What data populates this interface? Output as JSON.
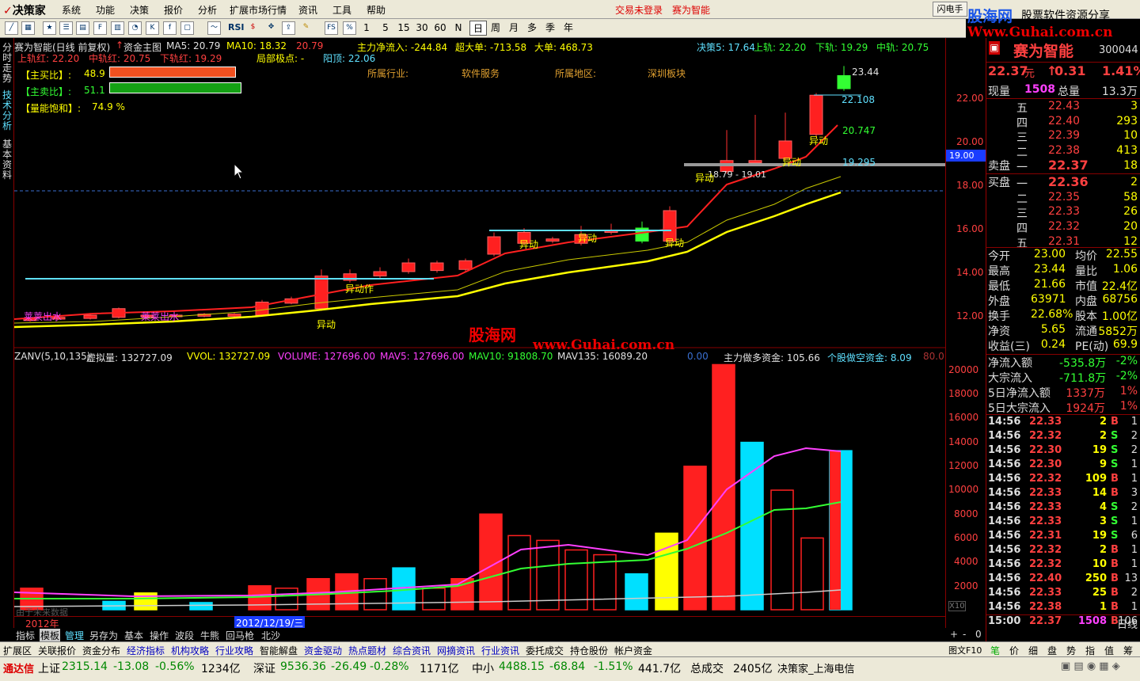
{
  "menubar": {
    "logo": "决策家",
    "items": [
      "系统",
      "功能",
      "决策",
      "报价",
      "分析",
      "扩展市场行情",
      "资讯",
      "工具",
      "帮助"
    ],
    "links": [
      "交易未登录",
      "赛为智能"
    ],
    "flash_btn": "闪电手",
    "ad_brand": "股海网",
    "ad_slogan": "股票软件资源分享",
    "ad_url": "Www.Guhai.com.cn"
  },
  "toolbar": {
    "icons": [
      "line-icon",
      "grid-icon",
      "fav-icon",
      "f10-icon",
      "fund-icon",
      "pie-icon",
      "k-icon",
      "tools-icon",
      "trend-icon",
      "rsi-icon",
      "money-icon",
      "move-icon",
      "export-icon",
      "pen-icon",
      "fs-icon",
      "pct-icon",
      "pick-icon"
    ],
    "rsi_label": "RSI",
    "periods": [
      "1",
      "5",
      "15",
      "30",
      "60",
      "N",
      "日",
      "周",
      "月",
      "多",
      "季",
      "年"
    ],
    "selected_period": "日"
  },
  "leftnav": {
    "items": [
      "分时走势",
      "技术分析",
      "基本资料"
    ]
  },
  "kline": {
    "title": "赛为智能(日线 前复权)",
    "main_chart_label": "资金主图",
    "ma5": "MA5: 20.79",
    "ma10": "MA10: 18.32",
    "ma_extra": "20.79",
    "main_inflow": "主力净流入: -244.84",
    "super_order": "超大单: -713.58",
    "big_order": "大单: 468.73",
    "upper_red": "上轨红: 22.20",
    "mid_red": "中轨红: 20.75",
    "lower_red": "下轨红: 19.29",
    "local_extreme": "局部极点: -",
    "resistance": "阳顶: 22.06",
    "decision5": "决策5: 17.64",
    "upper": "上轨: 22.20",
    "lower": "下轨: 19.29",
    "mid": "中轨: 20.75",
    "buy_ratio_label": "【主买比】:",
    "buy_ratio": "48.9",
    "sell_ratio_label": "【主卖比】:",
    "sell_ratio": "51.1",
    "pct_sign": "%",
    "energy_label": "【量能饱和】:",
    "energy": "74.9  %",
    "industry_label": "所属行业:",
    "industry": "软件服务",
    "region_label": "所属地区:",
    "region": "深圳板块",
    "yidong": "异动",
    "yidong_zuo": "异动作",
    "main_out": "莱莱出水",
    "price_22_44": "23.44",
    "price_22_108": "22.108",
    "price_20_747": "20.747",
    "price_19_295": "19.295",
    "range_text": "18.79 - 19.01",
    "hl_box": "19.00",
    "price_axis": [
      "22.00",
      "20.00",
      "18.00",
      "16.00",
      "14.00",
      "12.00"
    ]
  },
  "volume": {
    "zanv": "ZANV(5,10,135)",
    "virtual": "虚拟量: 132727.09",
    "vvol": "VVOL: 132727.09",
    "volume": "VOLUME: 127696.00",
    "mav5": "MAV5: 127696.00",
    "mav10": "MAV10: 91808.70",
    "mav135": "MAV135: 16089.20",
    "zero": "0.00",
    "main_long": "主力做多资金: 105.66",
    "retail_short": "个股做空资金: 8.09",
    "tail": "80.0",
    "axis": [
      "20000",
      "18000",
      "16000",
      "14000",
      "12000",
      "10000",
      "8000",
      "6000",
      "4000",
      "2000"
    ],
    "x10": "X10",
    "date_box": "2012/12/19/三",
    "year_label": "2012年",
    "no_data": "由于未来数据"
  },
  "watermark": {
    "text": "股海网",
    "url": "www.Guhai.com.cn"
  },
  "stock": {
    "name": "赛为智能",
    "code": "300044",
    "price": "22.37",
    "unit": "元",
    "change": "0.31",
    "pct": "1.41%",
    "now_label": "现量",
    "now_vol": "1508",
    "total_label": "总量",
    "total": "13.3万",
    "sell_label": "卖盘",
    "buy_label": "买盘",
    "sells": [
      {
        "lv": "五",
        "p": "22.43",
        "v": "3"
      },
      {
        "lv": "四",
        "p": "22.40",
        "v": "293"
      },
      {
        "lv": "三",
        "p": "22.39",
        "v": "10"
      },
      {
        "lv": "二",
        "p": "22.38",
        "v": "413"
      },
      {
        "lv": "一",
        "p": "22.37",
        "v": "18"
      }
    ],
    "buys": [
      {
        "lv": "一",
        "p": "22.36",
        "v": "2"
      },
      {
        "lv": "二",
        "p": "22.35",
        "v": "58"
      },
      {
        "lv": "三",
        "p": "22.33",
        "v": "26"
      },
      {
        "lv": "四",
        "p": "22.32",
        "v": "20"
      },
      {
        "lv": "五",
        "p": "22.31",
        "v": "12"
      }
    ],
    "stats": [
      [
        "今开",
        "23.00",
        "均价",
        "22.55"
      ],
      [
        "最高",
        "23.44",
        "量比",
        "1.06"
      ],
      [
        "最低",
        "21.66",
        "市值",
        "22.4亿"
      ],
      [
        "外盘",
        "63971",
        "内盘",
        "68756"
      ],
      [
        "换手",
        "22.68%",
        "股本",
        "1.00亿"
      ],
      [
        "净资",
        "5.65",
        "流通",
        "5852万"
      ],
      [
        "收益(三)",
        "0.24",
        "PE(动)",
        "69.9"
      ]
    ],
    "flows": [
      [
        "净流入额",
        "-535.8万",
        "-2%"
      ],
      [
        "大宗流入",
        "-711.8万",
        "-2%"
      ],
      [
        "5日净流入额",
        "1337万",
        "1%"
      ],
      [
        "5日大宗流入",
        "1924万",
        "1%"
      ]
    ],
    "ticks": [
      [
        "14:56",
        "22.33",
        "2",
        "B",
        "1"
      ],
      [
        "14:56",
        "22.32",
        "2",
        "S",
        "2"
      ],
      [
        "14:56",
        "22.30",
        "19",
        "S",
        "2"
      ],
      [
        "14:56",
        "22.30",
        "9",
        "S",
        "1"
      ],
      [
        "14:56",
        "22.32",
        "109",
        "B",
        "1"
      ],
      [
        "14:56",
        "22.33",
        "14",
        "B",
        "3"
      ],
      [
        "14:56",
        "22.33",
        "4",
        "S",
        "2"
      ],
      [
        "14:56",
        "22.33",
        "3",
        "S",
        "1"
      ],
      [
        "14:56",
        "22.31",
        "19",
        "S",
        "6"
      ],
      [
        "14:56",
        "22.32",
        "2",
        "B",
        "1"
      ],
      [
        "14:56",
        "22.32",
        "10",
        "B",
        "1"
      ],
      [
        "14:56",
        "22.40",
        "250",
        "B",
        "13"
      ],
      [
        "14:56",
        "22.33",
        "25",
        "B",
        "2"
      ],
      [
        "14:56",
        "22.38",
        "1",
        "B",
        "1"
      ],
      [
        "15:00",
        "22.37",
        "1508",
        "B",
        "106"
      ]
    ],
    "day_line": "日线",
    "plus": "+",
    "minus": "-",
    "zero": "0",
    "f10": "图文F10",
    "side_tabs": [
      "笔",
      "价",
      "细",
      "盘",
      "势",
      "指",
      "值",
      "筹"
    ]
  },
  "bottomtabs": [
    "指标",
    "模板",
    "管理",
    "另存为",
    "基本",
    "操作",
    "波段",
    "牛熊",
    "回马枪",
    "北沙"
  ],
  "funcbar": [
    "扩展区",
    "关联报价",
    "资金分布",
    "经济指标",
    "机构攻略",
    "行业攻略",
    "智能解盘",
    "资金驱动",
    "热点题材",
    "综合资讯",
    "网摘资讯",
    "行业资讯",
    "委托成交",
    "持仓股份",
    "帐户资金"
  ],
  "status": {
    "brand": "通达信",
    "sh_label": "上证",
    "sh": "2315.14",
    "sh_chg": "-13.08",
    "sh_pct": "-0.56%",
    "sh_amt": "1234亿",
    "sz_label": "深证",
    "sz": "9536.36",
    "sz_chg": "-26.49",
    "sz_pct": "-0.28%",
    "sz_amt": "1171亿",
    "zx_label": "中小",
    "zx": "4488.15",
    "zx_chg": "-68.84",
    "zx_pct": "-1.51%",
    "zx_amt": "441.7亿",
    "total_label": "总成交",
    "total": "2405亿",
    "server": "决策家_上海电信"
  }
}
